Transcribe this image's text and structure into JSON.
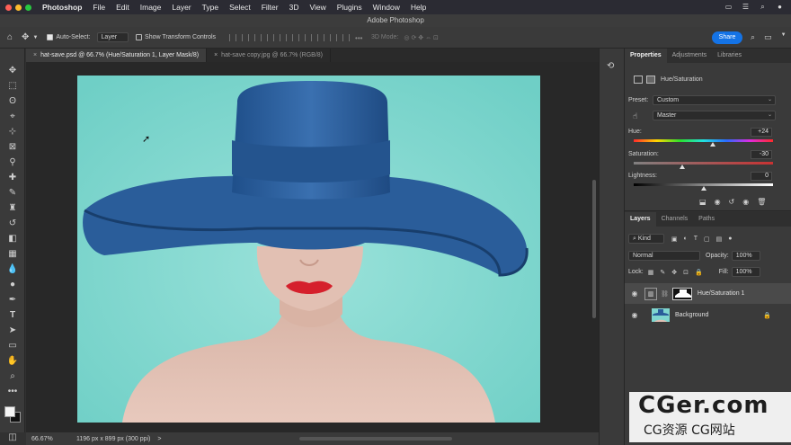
{
  "menubar": {
    "app": "Photoshop",
    "items": [
      "File",
      "Edit",
      "Image",
      "Layer",
      "Type",
      "Select",
      "Filter",
      "3D",
      "View",
      "Plugins",
      "Window",
      "Help"
    ]
  },
  "window": {
    "title": "Adobe Photoshop"
  },
  "options": {
    "auto_select_label": "Auto-Select:",
    "auto_select_value": "Layer",
    "transform_label": "Show Transform Controls",
    "mode_3d": "3D Mode:",
    "share": "Share"
  },
  "tabs": [
    {
      "label": "hat-save.psd @ 66.7% (Hue/Saturation 1, Layer Mask/8)"
    },
    {
      "label": "hat-save copy.jpg @ 66.7% (RGB/8)"
    }
  ],
  "status": {
    "zoom": "66.67%",
    "dims": "1196 px x 899 px (300 ppi)",
    "arrow": ">"
  },
  "properties": {
    "tabs": [
      "Properties",
      "Adjustments",
      "Libraries"
    ],
    "header": "Hue/Saturation",
    "preset_label": "Preset:",
    "preset_value": "Custom",
    "channel_value": "Master",
    "hue_label": "Hue:",
    "hue_value": "+24",
    "hue_fraction": 0.566,
    "saturation_label": "Saturation:",
    "saturation_value": "-30",
    "saturation_fraction": 0.35,
    "lightness_label": "Lightness:",
    "lightness_value": "0",
    "lightness_fraction": 0.5
  },
  "layers": {
    "tabs": [
      "Layers",
      "Channels",
      "Paths"
    ],
    "filter_value": "Kind",
    "blend_value": "Normal",
    "opacity_label": "Opacity:",
    "opacity_value": "100%",
    "lock_label": "Lock:",
    "fill_label": "Fill:",
    "fill_value": "100%",
    "items": [
      {
        "name": "Hue/Saturation 1"
      },
      {
        "name": "Background"
      }
    ]
  },
  "watermark": {
    "line1": "CGer.com",
    "line2": "CG资源 CG网站"
  },
  "colors": {
    "accent": "#1473e6",
    "backdrop": "#7fd6cf",
    "hat": "#2a5d9a"
  }
}
